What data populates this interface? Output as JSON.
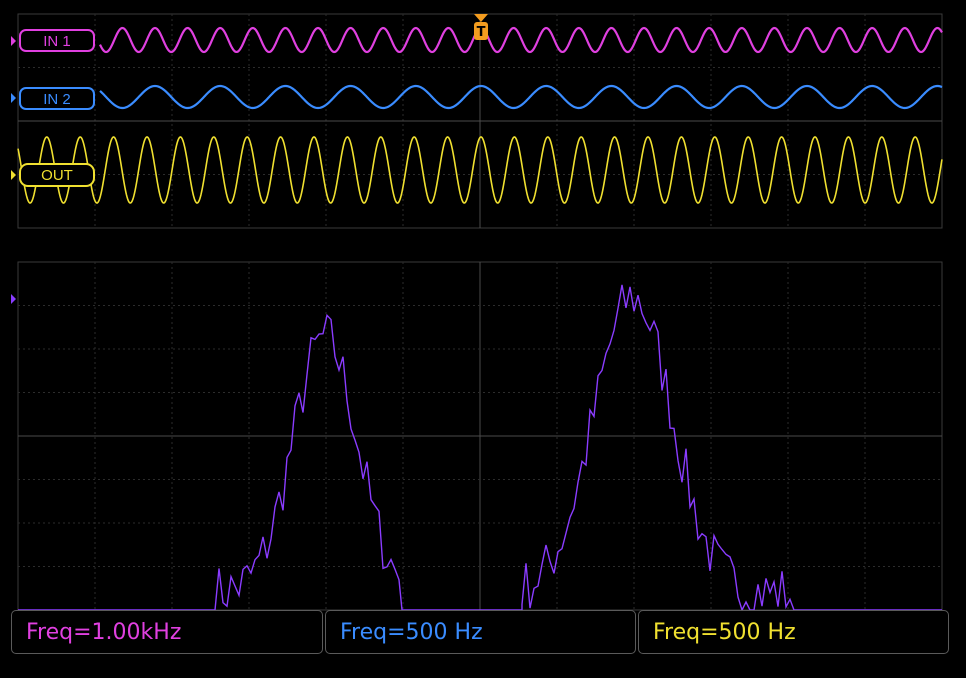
{
  "colors": {
    "background": "#000000",
    "grid": "#3a3a3a",
    "grid_dots": "#5a5a5a",
    "ch1": "#e040e0",
    "ch2": "#3a8cff",
    "ch3": "#f0e030",
    "fft": "#8a3cff",
    "trigger": "#f39c1f"
  },
  "channels": [
    {
      "label": "IN 1",
      "color": "#e040e0"
    },
    {
      "label": "IN 2",
      "color": "#3a8cff"
    },
    {
      "label": "OUT",
      "color": "#f0e030"
    }
  ],
  "trigger": {
    "label": "T",
    "icon": "trigger-marker-icon"
  },
  "measurements": [
    {
      "text": "Freq=1.00kHz",
      "color": "#e040e0"
    },
    {
      "text": "Freq=500 Hz",
      "color": "#3a8cff"
    },
    {
      "text": "Freq=500 Hz",
      "color": "#f0e030"
    }
  ],
  "chart_data": {
    "type": "line",
    "title": "",
    "xlabel": "",
    "ylabel": "",
    "grid": true,
    "series": [
      {
        "name": "IN 1",
        "cycles_on_screen": 26
      },
      {
        "name": "IN 2",
        "cycles_on_screen": 13
      },
      {
        "name": "OUT",
        "cycles_on_screen": 26,
        "carrier": "IN 1",
        "modulation": "IN 2"
      }
    ],
    "fft_peaks": [
      {
        "position_divisions": 4.2,
        "relative_level": 0.77
      },
      {
        "position_divisions": 8.2,
        "relative_level": 1.0
      }
    ]
  }
}
